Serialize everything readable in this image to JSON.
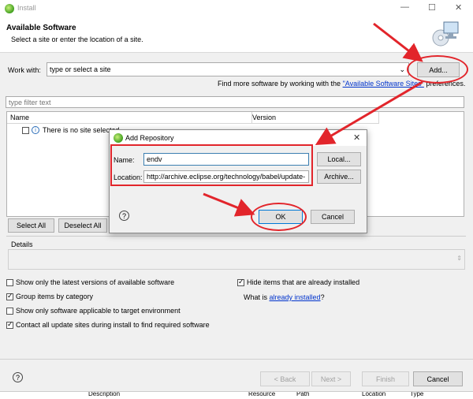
{
  "window": {
    "title": "Install",
    "minimize": "—",
    "maximize": "☐",
    "close": "✕"
  },
  "header": {
    "title": "Available Software",
    "subtitle": "Select a site or enter the location of a site."
  },
  "work_with": {
    "label": "Work with:",
    "placeholder": "type or select a site",
    "add_button": "Add..."
  },
  "find_more": {
    "prefix": "Find more software by working with the ",
    "link": "\"Available Software Sites\"",
    "suffix": " preferences."
  },
  "filter": {
    "placeholder": "type filter text"
  },
  "table": {
    "columns": [
      "Name",
      "Version"
    ],
    "rows": [
      {
        "name": "There is no site selected."
      }
    ]
  },
  "select_buttons": {
    "select_all": "Select All",
    "deselect_all": "Deselect All"
  },
  "details": {
    "label": "Details"
  },
  "options": {
    "latest_versions": "Show only the latest versions of available software",
    "group_by_category": "Group items by category",
    "applicable_only": "Show only software applicable to target environment",
    "contact_sites": "Contact all update sites during install to find required software",
    "hide_installed": "Hide items that are already installed",
    "what_is": "What is ",
    "already_installed": "already installed",
    "question": "?"
  },
  "footer": {
    "back": "< Back",
    "next": "Next >",
    "finish": "Finish",
    "cancel": "Cancel",
    "help": "?"
  },
  "bottom_strip": [
    "Description",
    "Resource",
    "Path",
    "Location",
    "Type"
  ],
  "dialog": {
    "title": "Add Repository",
    "name_label": "Name:",
    "name_value": "endv",
    "location_label": "Location:",
    "location_value": "http://archive.eclipse.org/technology/babel/update-",
    "local_button": "Local...",
    "archive_button": "Archive...",
    "ok_button": "OK",
    "cancel_button": "Cancel",
    "close": "✕",
    "help": "?"
  },
  "colors": {
    "annotation_red": "#e2252b",
    "link_blue": "#0033cc",
    "focus_blue": "#3c7fb1"
  }
}
